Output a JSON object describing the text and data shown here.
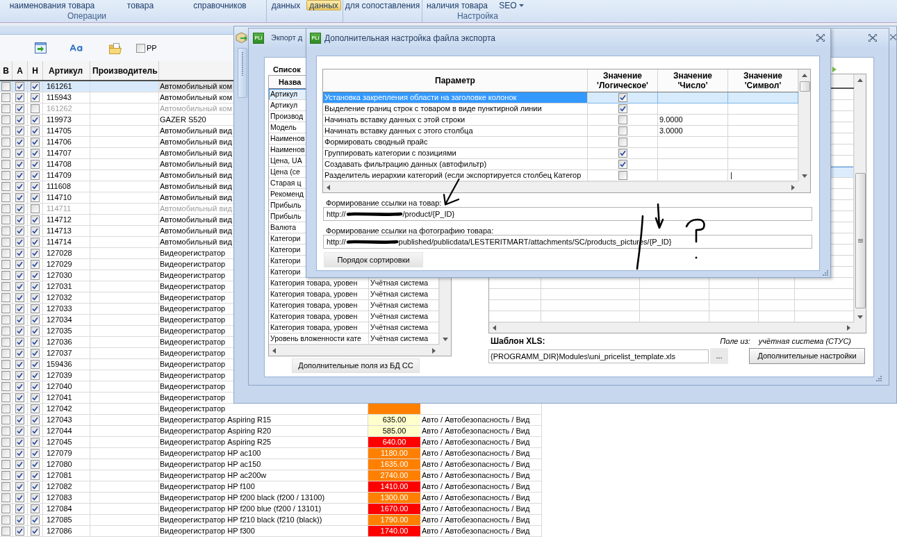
{
  "ribbon": {
    "groups": [
      {
        "label": "Операции",
        "buttons": [
          {
            "label": "наименования товара",
            "kind": "button",
            "selected": false
          },
          {
            "label": "товара",
            "kind": "button",
            "selected": false
          }
        ]
      },
      {
        "buttons": [
          {
            "label": "справочников",
            "kind": "button",
            "selected": false
          }
        ]
      },
      {
        "buttons": [
          {
            "label": "данных",
            "kind": "button",
            "selected": false
          },
          {
            "label": "данных",
            "kind": "button",
            "selected": true
          }
        ]
      },
      {
        "buttons": [
          {
            "label": "для сопоставления",
            "kind": "button",
            "selected": false
          }
        ]
      },
      {
        "label": "Настройка",
        "buttons": [
          {
            "label": "наличия товара",
            "kind": "button",
            "selected": false
          },
          {
            "label": "SEO",
            "kind": "menu",
            "selected": false
          }
        ]
      }
    ]
  },
  "toolbar": {
    "checkbox": {
      "label": "PP",
      "checked": false
    }
  },
  "table": {
    "columns": [
      "В",
      "А",
      "Н",
      "Артикул",
      "Производитель"
    ],
    "rows": [
      {
        "checks": [
          false,
          true,
          true
        ],
        "article": "161261",
        "name": "Автомобильный ком",
        "selected": true,
        "inactive": false
      },
      {
        "checks": [
          false,
          true,
          true
        ],
        "article": "115943",
        "name": "Автомобильный ком",
        "selected": false,
        "inactive": false
      },
      {
        "checks": [
          false,
          true,
          false
        ],
        "article": "161262",
        "name": "Автомобильный ком",
        "selected": false,
        "inactive": true
      },
      {
        "checks": [
          false,
          true,
          true
        ],
        "article": "119973",
        "name": "GAZER S520",
        "selected": false,
        "inactive": false
      },
      {
        "checks": [
          false,
          true,
          true
        ],
        "article": "114705",
        "name": "Автомобильный вид",
        "selected": false,
        "inactive": false
      },
      {
        "checks": [
          false,
          true,
          true
        ],
        "article": "114706",
        "name": "Автомобильный вид",
        "selected": false,
        "inactive": false
      },
      {
        "checks": [
          false,
          true,
          true
        ],
        "article": "114707",
        "name": "Автомобильный вид",
        "selected": false,
        "inactive": false
      },
      {
        "checks": [
          false,
          true,
          true
        ],
        "article": "114708",
        "name": "Автомобильный вид",
        "selected": false,
        "inactive": false
      },
      {
        "checks": [
          false,
          true,
          true
        ],
        "article": "114709",
        "name": "Автомобильный вид",
        "selected": false,
        "inactive": false
      },
      {
        "checks": [
          false,
          true,
          true
        ],
        "article": "111608",
        "name": "Автомобильный вид",
        "selected": false,
        "inactive": false
      },
      {
        "checks": [
          false,
          true,
          true
        ],
        "article": "114710",
        "name": "Автомобильный вид",
        "selected": false,
        "inactive": false
      },
      {
        "checks": [
          false,
          true,
          false
        ],
        "article": "114711",
        "name": "Автомобильный вид",
        "selected": false,
        "inactive": true
      },
      {
        "checks": [
          false,
          true,
          true
        ],
        "article": "114712",
        "name": "Автомобильный вид",
        "selected": false,
        "inactive": false
      },
      {
        "checks": [
          false,
          true,
          true
        ],
        "article": "114713",
        "name": "Автомобильный вид",
        "selected": false,
        "inactive": false
      },
      {
        "checks": [
          false,
          true,
          true
        ],
        "article": "114714",
        "name": "Автомобильный вид",
        "selected": false,
        "inactive": false
      },
      {
        "checks": [
          false,
          true,
          true
        ],
        "article": "127028",
        "name": "Видеорегистратор",
        "selected": false,
        "inactive": false
      },
      {
        "checks": [
          false,
          true,
          true
        ],
        "article": "127029",
        "name": "Видеорегистратор",
        "selected": false,
        "inactive": false
      },
      {
        "checks": [
          false,
          true,
          true
        ],
        "article": "127030",
        "name": "Видеорегистратор",
        "selected": false,
        "inactive": false
      },
      {
        "checks": [
          false,
          true,
          true
        ],
        "article": "127031",
        "name": "Видеорегистратор",
        "selected": false,
        "inactive": false
      },
      {
        "checks": [
          false,
          true,
          true
        ],
        "article": "127032",
        "name": "Видеорегистратор",
        "selected": false,
        "inactive": false
      },
      {
        "checks": [
          false,
          true,
          true
        ],
        "article": "127033",
        "name": "Видеорегистратор",
        "selected": false,
        "inactive": false
      },
      {
        "checks": [
          false,
          true,
          true
        ],
        "article": "127034",
        "name": "Видеорегистратор",
        "selected": false,
        "inactive": false
      },
      {
        "checks": [
          false,
          true,
          true
        ],
        "article": "127035",
        "name": "Видеорегистратор",
        "selected": false,
        "inactive": false
      },
      {
        "checks": [
          false,
          true,
          true
        ],
        "article": "127036",
        "name": "Видеорегистратор",
        "selected": false,
        "inactive": false
      },
      {
        "checks": [
          false,
          true,
          true
        ],
        "article": "127037",
        "name": "Видеорегистратор",
        "selected": false,
        "inactive": false
      },
      {
        "checks": [
          false,
          true,
          true
        ],
        "article": "159436",
        "name": "Видеорегистратор",
        "selected": false,
        "inactive": false
      },
      {
        "checks": [
          false,
          true,
          true
        ],
        "article": "127039",
        "name": "Видеорегистратор",
        "selected": false,
        "inactive": false
      },
      {
        "checks": [
          false,
          true,
          true
        ],
        "article": "127040",
        "name": "Видеорегистратор",
        "selected": false,
        "inactive": false
      },
      {
        "checks": [
          false,
          true,
          true
        ],
        "article": "127041",
        "name": "Видеорегистратор",
        "selected": false,
        "inactive": false
      },
      {
        "checks": [
          false,
          true,
          true
        ],
        "article": "127042",
        "name": "Видеорегистратор",
        "color": "#ff8000",
        "selected": false,
        "inactive": false
      },
      {
        "checks": [
          false,
          true,
          true
        ],
        "article": "127043",
        "name": "Видеорегистратор Aspiring R15",
        "price": "635.00",
        "color": "#ffffcc",
        "category": "Авто / Автобезопасность / Вид",
        "selected": false,
        "inactive": false
      },
      {
        "checks": [
          false,
          true,
          true
        ],
        "article": "127044",
        "name": "Видеорегистратор Aspiring R20",
        "price": "585.00",
        "color": "#ffffcc",
        "category": "Авто / Автобезопасность / Вид",
        "selected": false,
        "inactive": false
      },
      {
        "checks": [
          false,
          true,
          true
        ],
        "article": "127045",
        "name": "Видеорегистратор Aspiring R25",
        "price": "640.00",
        "color": "#ff0000",
        "category": "Авто / Автобезопасность / Вид",
        "selected": false,
        "inactive": false
      },
      {
        "checks": [
          false,
          true,
          true
        ],
        "article": "127079",
        "name": "Видеорегистратор HP ac100",
        "price": "1180.00",
        "color": "#ff8000",
        "category": "Авто / Автобезопасность / Вид",
        "selected": false,
        "inactive": false
      },
      {
        "checks": [
          false,
          true,
          true
        ],
        "article": "127080",
        "name": "Видеорегистратор HP ac150",
        "price": "1635.00",
        "color": "#ff8000",
        "category": "Авто / Автобезопасность / Вид",
        "selected": false,
        "inactive": false
      },
      {
        "checks": [
          false,
          true,
          true
        ],
        "article": "127081",
        "name": "Видеорегистратор HP ac200w",
        "price": "2740.00",
        "color": "#ff8000",
        "category": "Авто / Автобезопасность / Вид",
        "selected": false,
        "inactive": false
      },
      {
        "checks": [
          false,
          true,
          true
        ],
        "article": "127082",
        "name": "Видеорегистратор HP f100",
        "price": "1410.00",
        "color": "#ff0000",
        "category": "Авто / Автобезопасность / Вид",
        "selected": false,
        "inactive": false
      },
      {
        "checks": [
          false,
          true,
          true
        ],
        "article": "127083",
        "name": "Видеорегистратор HP f200 black (f200 / 13100)",
        "price": "1300.00",
        "color": "#ff8000",
        "category": "Авто / Автобезопасность / Вид",
        "selected": false,
        "inactive": false
      },
      {
        "checks": [
          false,
          true,
          true
        ],
        "article": "127084",
        "name": "Видеорегистратор HP f200 blue (f200 / 13101)",
        "price": "1670.00",
        "color": "#ff0000",
        "category": "Авто / Автобезопасность / Вид",
        "selected": false,
        "inactive": false
      },
      {
        "checks": [
          false,
          true,
          true
        ],
        "article": "127085",
        "name": "Видеорегистратор HP f210 black (f210 (black))",
        "price": "1790.00",
        "color": "#ff8000",
        "category": "Авто / Автобезопасность / Вид",
        "selected": false,
        "inactive": false
      },
      {
        "checks": [
          false,
          true,
          true
        ],
        "article": "127086",
        "name": "Видеорегистратор HP f300",
        "price": "1740.00",
        "color": "#ff0000",
        "category": "Авто / Автобезопасность / Вид",
        "selected": false,
        "inactive": false
      }
    ]
  },
  "export_window": {
    "logo": "PLi",
    "title": "Экпорт д",
    "fields_list": {
      "title": "Список",
      "columns": [
        "Назва"
      ],
      "rows": [
        {
          "name": "Артикул",
          "selected": true
        },
        {
          "name": "Артикул",
          "selected": false
        },
        {
          "name": "Производ",
          "selected": false
        },
        {
          "name": "Модель",
          "selected": false
        },
        {
          "name": "Наименов",
          "selected": false
        },
        {
          "name": "Наименов",
          "selected": false
        },
        {
          "name": "Цена, UA",
          "selected": false
        },
        {
          "name": "Цена (се",
          "selected": false
        },
        {
          "name": "Старая ц",
          "selected": false
        },
        {
          "name": "Рекоменд",
          "selected": false
        },
        {
          "name": "Прибыль",
          "selected": false
        },
        {
          "name": "Прибыль",
          "selected": false
        },
        {
          "name": "Валюта",
          "selected": false
        },
        {
          "name": "Категори",
          "selected": false
        },
        {
          "name": "Категори",
          "selected": false
        },
        {
          "name": "Категори",
          "selected": false
        },
        {
          "name": "Категори",
          "selected": false
        },
        {
          "name": "Категория товара, уровен",
          "source": "Учётная система",
          "selected": false
        },
        {
          "name": "Категория товара, уровен",
          "source": "Учётная система",
          "selected": false
        },
        {
          "name": "Категория товара, уровен",
          "source": "Учётная система",
          "selected": false
        },
        {
          "name": "Категория товара, уровен",
          "source": "Учётная система",
          "selected": false
        },
        {
          "name": "Категория товара, уровен",
          "source": "Учётная система",
          "selected": false
        },
        {
          "name": "Уровень вложенности кате",
          "source": "Учётная система",
          "selected": false
        }
      ]
    },
    "extra_fields_button": "Дополнительные поля из БД СС",
    "grid": {
      "rows": [
        {
          "selected": false
        },
        {
          "selected": false
        },
        {
          "selected": false
        },
        {
          "selected": false
        },
        {
          "selected": false
        },
        {
          "selected": false
        },
        {
          "selected": false
        },
        {
          "selected": true
        },
        {
          "selected": false
        },
        {
          "selected": false
        },
        {
          "selected": false
        },
        {
          "selected": false
        },
        {
          "selected": false
        },
        {
          "selected": false
        },
        {
          "selected": false
        },
        {
          "selected": false
        },
        {
          "selected": false
        },
        {
          "selected": false
        },
        {
          "selected": false
        },
        {
          "selected": false
        },
        {
          "selected": false
        }
      ]
    },
    "template": {
      "label": "Шаблон XLS:",
      "value": "{PROGRAMM_DIR}Modules\\uni_pricelist_template.xls",
      "browse_button": "..."
    },
    "field_source": {
      "label": "Поле из:",
      "value": "учётная система (СТУС)"
    },
    "settings_button": "Дополнительные настройки"
  },
  "settings_dialog": {
    "logo": "PLi",
    "title": "Дополнительная настройка файла экспорта",
    "table": {
      "columns": [
        "Параметр",
        "Значение 'Логическое'",
        "Значение 'Число'",
        "Значение 'Символ'"
      ],
      "rows": [
        {
          "parameter": "Установка закрепления области на заголовке колонок",
          "logical": true,
          "selected": true
        },
        {
          "parameter": "Выделение границ строк с товаром в виде пунктирной линии",
          "logical": true,
          "selected": false
        },
        {
          "parameter": "Начинать вставку данных с этой строки",
          "logical": false,
          "number": "9.0000",
          "selected": false
        },
        {
          "parameter": "Начинать вставку данных с этого столбца",
          "logical": false,
          "number": "3.0000",
          "selected": false
        },
        {
          "parameter": "Формировать сводный прайс",
          "logical": false,
          "selected": false
        },
        {
          "parameter": "Группировать категории с позициями",
          "logical": true,
          "selected": false
        },
        {
          "parameter": "Создавать фильтрацию данных (автофильтр)",
          "logical": true,
          "selected": false
        },
        {
          "parameter": "Разделитель иерархии категорий (если экспортируется столбец Категор",
          "logical": false,
          "symbol": "|",
          "selected": false
        }
      ]
    },
    "product_link": {
      "label": "Формирование ссылки на товар:",
      "value_start": "http://",
      "redacted": true,
      "value_end": "/product/{P_ID}"
    },
    "photo_link": {
      "label": "Формирование ссылки на фотографию товара:",
      "value_start": "http://",
      "redacted": true,
      "value_end": "published/publicdata/LESTERITMART/attachments/SC/products_pictures/{P_ID}"
    },
    "sort_button": "Порядок сортировки"
  }
}
